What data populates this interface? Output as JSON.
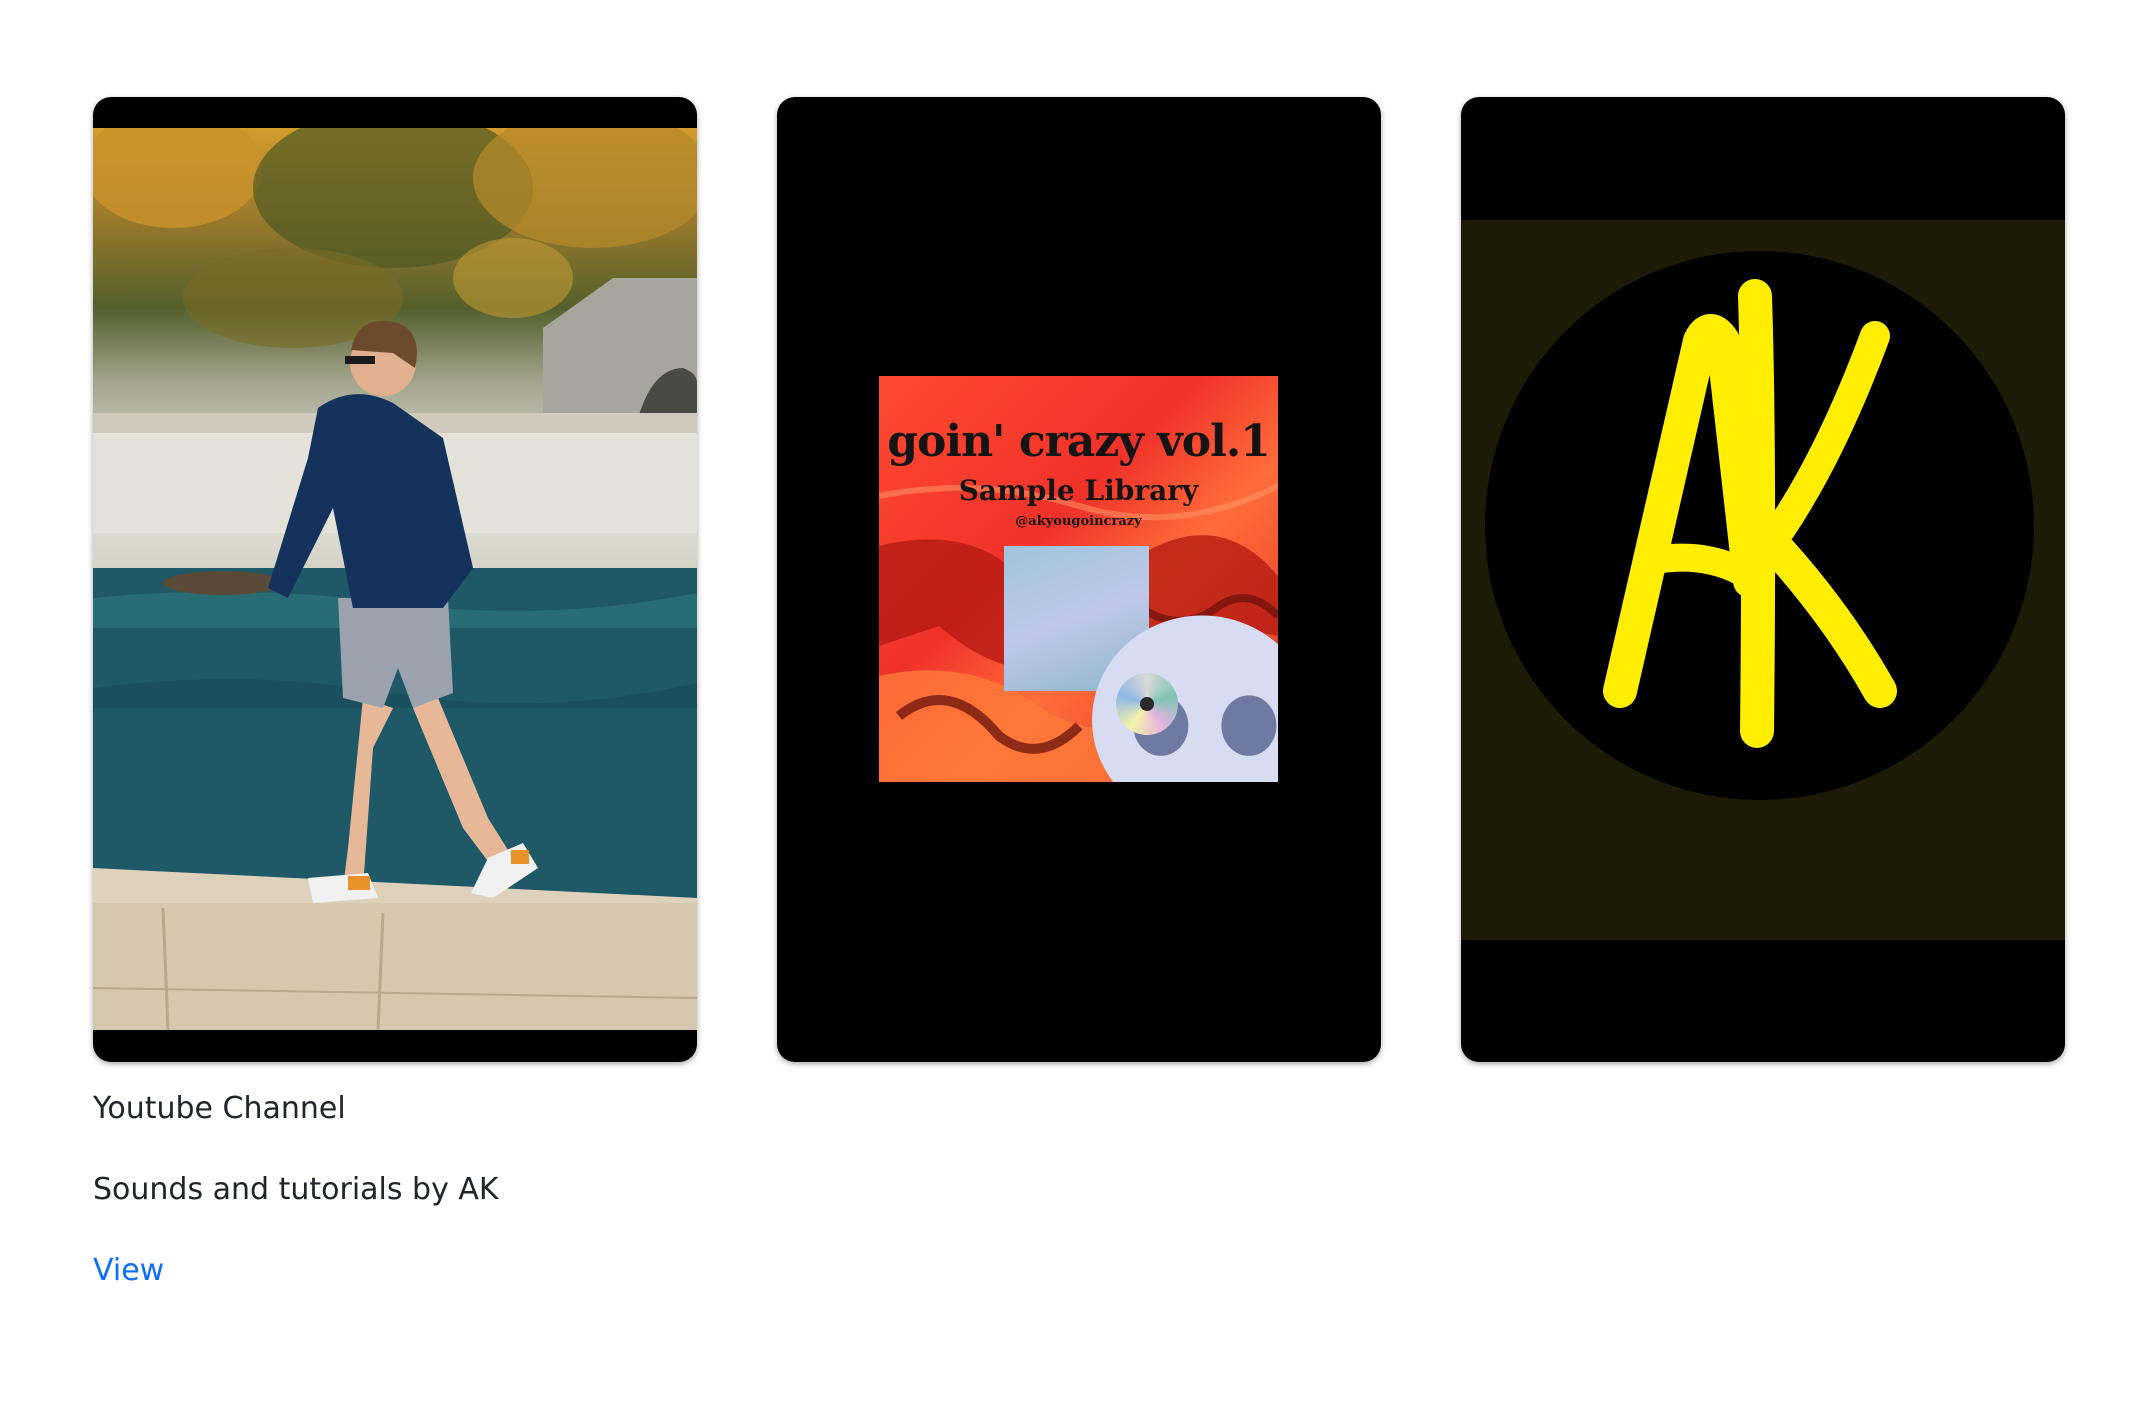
{
  "cards": [
    {
      "image_alt": "man-walking-by-sea-photo"
    },
    {
      "image_alt": "goin-crazy-album-cover",
      "album_title": "goin' crazy vol.1",
      "album_subtitle": "Sample Library",
      "album_handle": "@akyougoincrazy"
    },
    {
      "image_alt": "ak-logo",
      "logo_text": "AK"
    }
  ],
  "caption": {
    "title": "Youtube Channel",
    "description": "Sounds and tutorials by AK",
    "link_label": "View"
  },
  "colors": {
    "link": "#0d6efd",
    "text": "#212529",
    "logo_yellow": "#ffee00",
    "card_bg": "#000000"
  }
}
